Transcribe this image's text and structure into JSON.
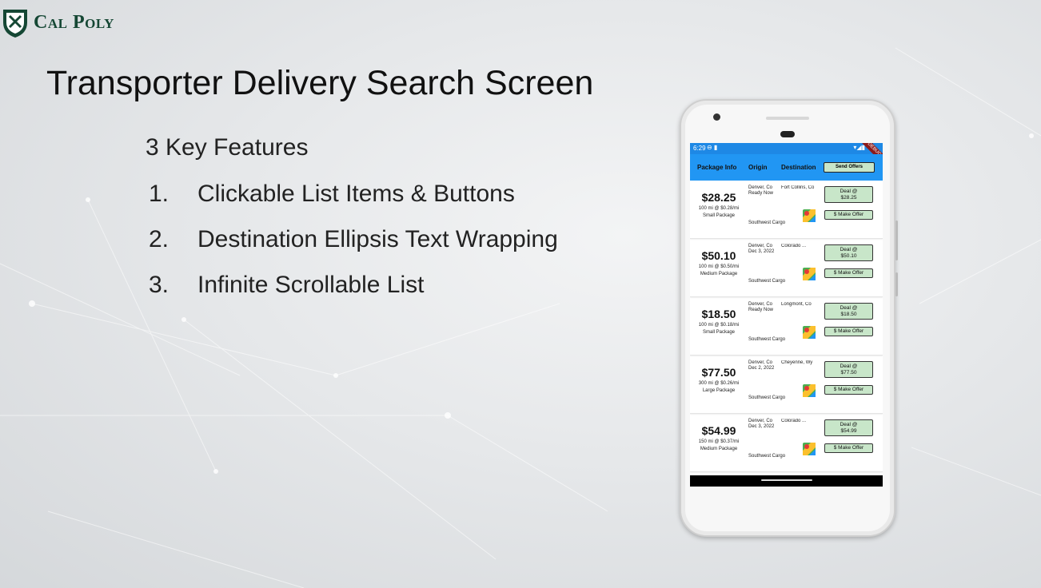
{
  "logo": {
    "text": "Cal Poly"
  },
  "slide": {
    "title": "Transporter Delivery Search Screen",
    "subtitle": "3 Key Features",
    "features": [
      {
        "num": "1.",
        "text": "Clickable List Items & Buttons"
      },
      {
        "num": "2.",
        "text": "Destination Ellipsis Text Wrapping"
      },
      {
        "num": "3.",
        "text": "Infinite Scrollable List"
      }
    ]
  },
  "phone": {
    "status": {
      "time": "6:29",
      "debug_banner": "DEBUG"
    },
    "header": {
      "package_info": "Package Info",
      "origin": "Origin",
      "destination": "Destination",
      "send_offers": "Send Offers"
    },
    "items": [
      {
        "price": "$28.25",
        "rate": "100 mi @ $0.28/mi",
        "size": "Small Package",
        "origin": "Denver, Co",
        "date": "Ready Now",
        "destination": "Fort Collins, Co",
        "company": "Southwest Cargo",
        "deal": "Deal @",
        "deal_price": "$28.25",
        "offer": "$ Make Offer"
      },
      {
        "price": "$50.10",
        "rate": "100 mi @ $0.50/mi",
        "size": "Medium Package",
        "origin": "Denver, Co",
        "date": "Dec 3, 2022",
        "destination": "Colorado ...",
        "company": "Southwest Cargo",
        "deal": "Deal @",
        "deal_price": "$50.10",
        "offer": "$ Make Offer"
      },
      {
        "price": "$18.50",
        "rate": "100 mi @ $0.18/mi",
        "size": "Small Package",
        "origin": "Denver, Co",
        "date": "Ready Now",
        "destination": "Longmont, Co",
        "company": "Southwest Cargo",
        "deal": "Deal @",
        "deal_price": "$18.50",
        "offer": "$ Make Offer"
      },
      {
        "price": "$77.50",
        "rate": "300 mi @ $0.26/mi",
        "size": "Large Package",
        "origin": "Denver, Co",
        "date": "Dec 2, 2022",
        "destination": "Cheyenne, Wy",
        "company": "Southwest Cargo",
        "deal": "Deal @",
        "deal_price": "$77.50",
        "offer": "$ Make Offer"
      },
      {
        "price": "$54.99",
        "rate": "150 mi @ $0.37/mi",
        "size": "Medium Package",
        "origin": "Denver, Co",
        "date": "Dec 3, 2022",
        "destination": "Colorado ...",
        "company": "Southwest Cargo",
        "deal": "Deal @",
        "deal_price": "$54.99",
        "offer": "$ Make Offer"
      }
    ]
  },
  "colors": {
    "brand_green": "#154734",
    "app_blue": "#2196f3",
    "button_green": "#c8e6c9"
  }
}
